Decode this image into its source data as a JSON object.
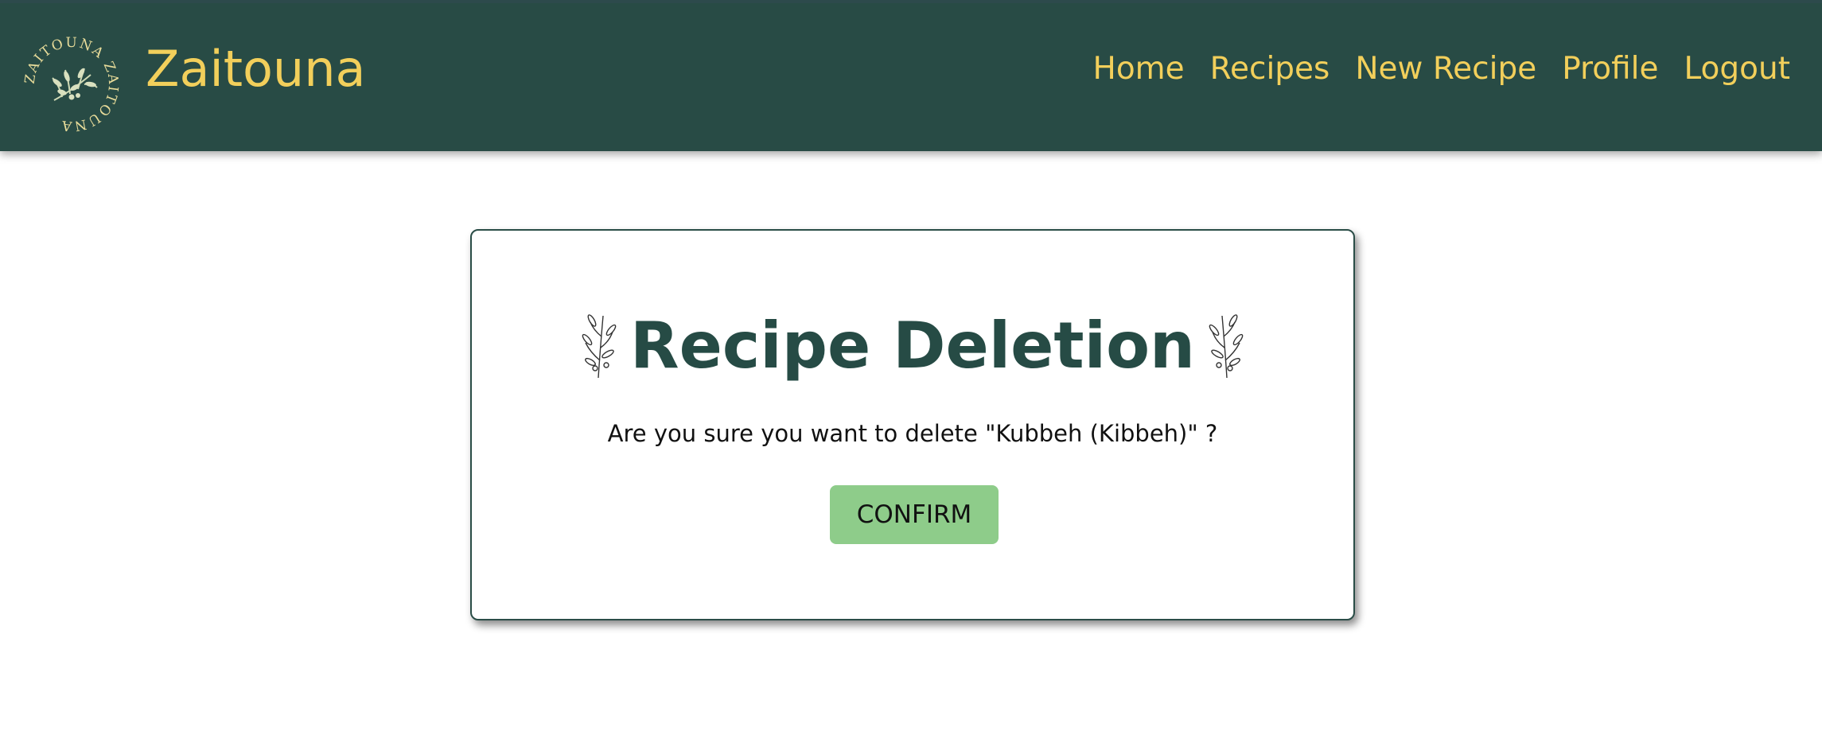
{
  "brand": {
    "name": "Zaitouna",
    "logo_ring_text": "ZAITOUNA ZAITOUNA",
    "colors": {
      "header_bg": "#284b45",
      "accent": "#f2cf5b"
    }
  },
  "nav": {
    "home": "Home",
    "recipes": "Recipes",
    "new_recipe": "New Recipe",
    "profile": "Profile",
    "logout": "Logout"
  },
  "dialog": {
    "title": "Recipe Deletion",
    "message": "Are you sure you want to delete \"Kubbeh (Kibbeh)\" ?",
    "confirm_label": "CONFIRM",
    "colors": {
      "title": "#264b45",
      "button_bg": "#8ecc8a"
    },
    "icons": [
      "olive-branch-icon",
      "olive-branch-icon"
    ]
  }
}
